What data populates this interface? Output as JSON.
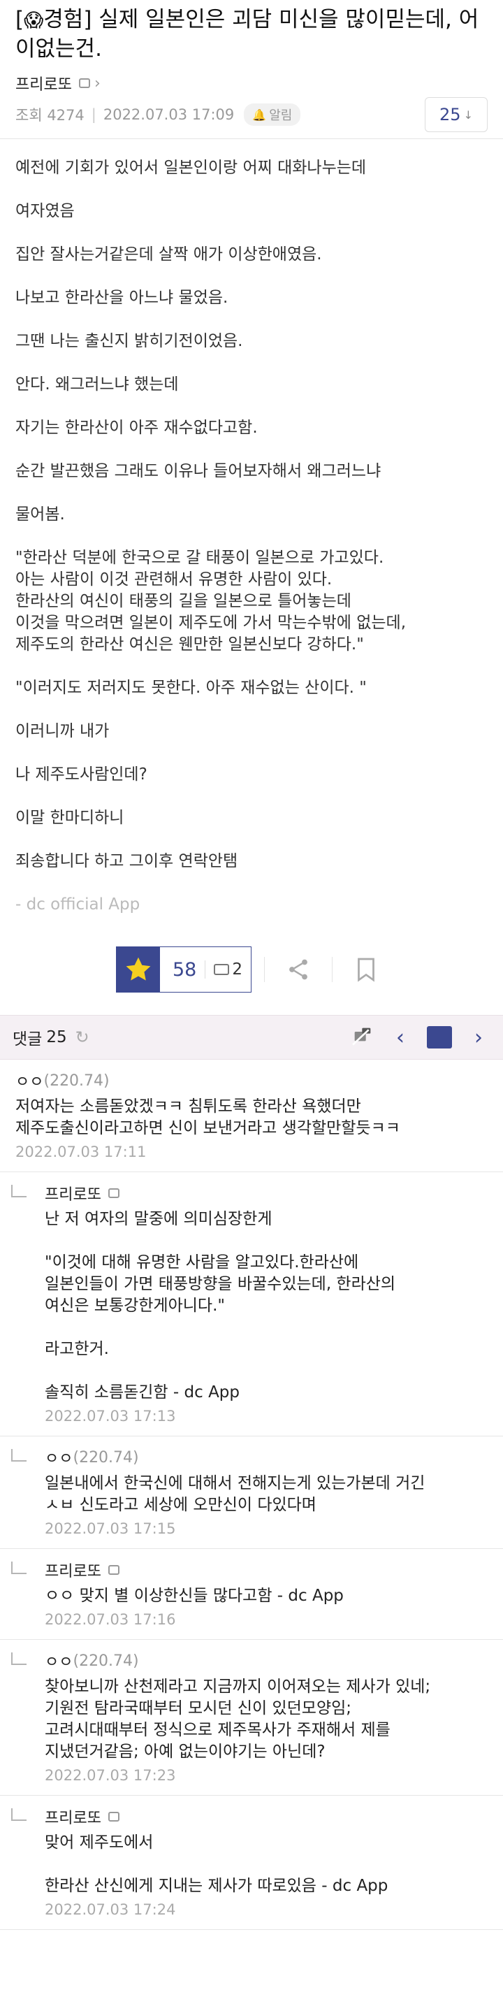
{
  "post": {
    "emoji": "😱",
    "category": "경험",
    "title": "실제 일본인은 괴담 미신을 많이믿는데, 어이없는건.",
    "author": "프리로또",
    "views": "조회 4274",
    "date": "2022.07.03 17:09",
    "alarm_label": "알림",
    "comment_count": "25",
    "body": [
      "예전에 기회가 있어서 일본인이랑 어찌 대화나누는데",
      "여자였음",
      "집안 잘사는거같은데 살짝 애가 이상한애였음.",
      "나보고 한라산을 아느냐 물었음.",
      "그땐 나는 출신지 밝히기전이었음.",
      "안다. 왜그러느냐 했는데",
      "자기는 한라산이 아주 재수없다고함.",
      "순간 발끈했음 그래도 이유나 들어보자해서 왜그러느냐",
      "물어봄.",
      "\"한라산 덕분에 한국으로 갈 태풍이 일본으로 가고있다.\n아는 사람이 이것 관련해서 유명한 사람이 있다.\n한라산의 여신이 태풍의 길을 일본으로 틀어놓는데\n이것을 막으려면 일본이 제주도에 가서 막는수밖에 없는데,\n제주도의 한라산 여신은 웬만한 일본신보다 강하다.\"",
      "\"이러지도 저러지도 못한다. 아주 재수없는 산이다. \"",
      "이러니까 내가",
      "나 제주도사람인데?",
      "이말 한마디하니",
      "죄송합니다 하고 그이후 연락안탬"
    ],
    "app_sig": "- dc official App"
  },
  "vote": {
    "up": "58",
    "down": "2"
  },
  "comments_bar": {
    "label": "댓글",
    "count": "25"
  },
  "comments": [
    {
      "reply": false,
      "author": "ㅇㅇ",
      "ip": "(220.74)",
      "badge": false,
      "text": "저여자는 소름돋았겠ㅋㅋ 침튀도록 한라산 욕했더만\n제주도출신이라고하면 신이 보낸거라고 생각할만할듯ㅋㅋ",
      "date": "2022.07.03 17:11"
    },
    {
      "reply": true,
      "author": "프리로또",
      "ip": "",
      "badge": true,
      "text": "난 저 여자의 말중에 의미심장한게\n\n\"이것에 대해 유명한 사람을 알고있다.한라산에\n일본인들이 가면 태풍방향을 바꿀수있는데, 한라산의\n여신은 보통강한게아니다.\"\n\n라고한거.\n\n솔직히 소름돋긴함 - dc App",
      "date": "2022.07.03 17:13"
    },
    {
      "reply": true,
      "author": "ㅇㅇ",
      "ip": "(220.74)",
      "badge": false,
      "text": "일본내에서 한국신에 대해서 전해지는게 있는가본데 거긴\nㅅㅂ 신도라고 세상에 오만신이 다있다며",
      "date": "2022.07.03 17:15"
    },
    {
      "reply": true,
      "author": "프리로또",
      "ip": "",
      "badge": true,
      "text": "ㅇㅇ 맞지 별 이상한신들 많다고함 - dc App",
      "date": "2022.07.03 17:16"
    },
    {
      "reply": true,
      "author": "ㅇㅇ",
      "ip": "(220.74)",
      "badge": false,
      "text": "찾아보니까 산천제라고 지금까지 이어져오는 제사가 있네;\n기원전 탐라국때부터 모시던 신이 있던모양임;\n고려시대때부터 정식으로 제주목사가 주재해서 제를\n지냈던거같음; 아예 없는이야기는 아닌데?",
      "date": "2022.07.03 17:23"
    },
    {
      "reply": true,
      "author": "프리로또",
      "ip": "",
      "badge": true,
      "text": "맞어 제주도에서\n\n한라산 산신에게 지내는 제사가 따로있음 - dc App",
      "date": "2022.07.03 17:24"
    }
  ]
}
